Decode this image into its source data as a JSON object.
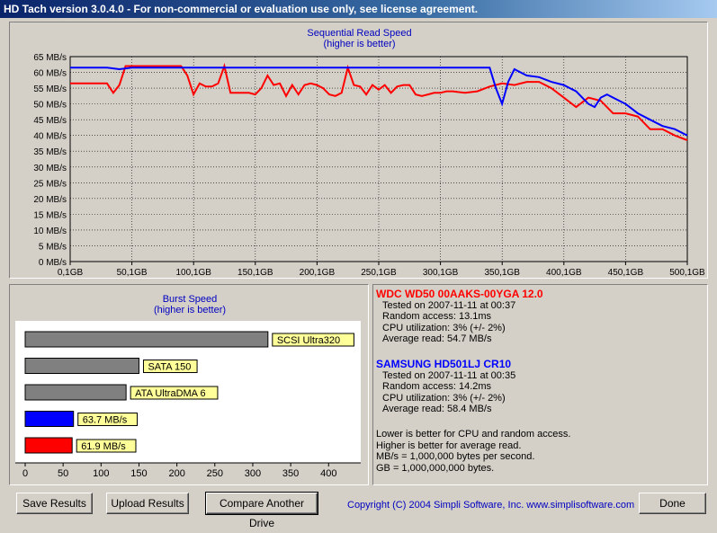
{
  "window": {
    "title": "HD Tach version 3.0.4.0  - For non-commercial or evaluation use only, see license agreement."
  },
  "seq_chart": {
    "title": "Sequential Read Speed",
    "subtitle": "(higher is better)"
  },
  "burst_chart": {
    "title": "Burst Speed",
    "subtitle": "(higher is better)"
  },
  "chart_data": [
    {
      "type": "line",
      "title": "Sequential Read Speed",
      "subtitle": "(higher is better)",
      "xlabel": "",
      "ylabel": "",
      "x_ticks": [
        "0,1GB",
        "50,1GB",
        "100,1GB",
        "150,1GB",
        "200,1GB",
        "250,1GB",
        "300,1GB",
        "350,1GB",
        "400,1GB",
        "450,1GB",
        "500,1GB"
      ],
      "y_ticks": [
        "0 MB/s",
        "5 MB/s",
        "10 MB/s",
        "15 MB/s",
        "20 MB/s",
        "25 MB/s",
        "30 MB/s",
        "35 MB/s",
        "40 MB/s",
        "45 MB/s",
        "50 MB/s",
        "55 MB/s",
        "60 MB/s",
        "65 MB/s"
      ],
      "xlim": [
        0.1,
        500.1
      ],
      "ylim": [
        0,
        65
      ],
      "grid": true,
      "series": [
        {
          "name": "WDC WD50 00AAKS-00YGA 12.0",
          "color": "#ff0000",
          "x": [
            0.1,
            10,
            20,
            30,
            35,
            40,
            45,
            50,
            55,
            60,
            65,
            70,
            75,
            80,
            85,
            90,
            95,
            100,
            105,
            110,
            115,
            120,
            125,
            130,
            135,
            140,
            145,
            150,
            155,
            160,
            165,
            170,
            175,
            180,
            185,
            190,
            195,
            200,
            205,
            210,
            215,
            220,
            225,
            230,
            235,
            240,
            245,
            250,
            255,
            260,
            265,
            270,
            275,
            280,
            285,
            290,
            295,
            300,
            305,
            310,
            320,
            330,
            340,
            350,
            360,
            370,
            380,
            390,
            400,
            410,
            420,
            430,
            440,
            450,
            460,
            470,
            480,
            490,
            500.1
          ],
          "y": [
            56.5,
            56.5,
            56.5,
            56.5,
            53.5,
            56,
            62,
            62,
            62,
            62,
            62,
            62,
            62,
            62,
            62,
            62,
            59,
            53,
            56.5,
            55.5,
            55.5,
            56.5,
            62,
            53.5,
            53.5,
            53.5,
            53.5,
            53,
            55,
            59,
            56,
            56.5,
            52.5,
            56,
            53,
            56,
            56.5,
            56,
            55,
            53,
            52.5,
            53.5,
            61.5,
            56,
            55.5,
            53,
            56,
            54.5,
            56,
            53.5,
            55.5,
            56,
            56,
            53,
            52.5,
            53,
            53.5,
            53.5,
            54,
            54,
            53.5,
            54,
            55.5,
            56.5,
            56,
            57,
            57,
            55,
            52,
            49,
            52,
            51,
            47,
            47,
            46,
            42,
            42,
            40,
            38.5
          ]
        },
        {
          "name": "SAMSUNG HD501LJ CR10",
          "color": "#0000ff",
          "x": [
            0.1,
            10,
            20,
            30,
            40,
            50,
            60,
            70,
            80,
            90,
            100,
            150,
            200,
            250,
            300,
            340,
            345,
            350,
            355,
            360,
            365,
            370,
            380,
            390,
            400,
            405,
            410,
            415,
            420,
            425,
            430,
            435,
            440,
            445,
            450,
            460,
            470,
            480,
            490,
            500.1
          ],
          "y": [
            61.5,
            61.5,
            61.5,
            61.5,
            61,
            61.5,
            61.5,
            61.5,
            61.5,
            61.5,
            61.5,
            61.5,
            61.5,
            61.5,
            61.5,
            61.5,
            55,
            50,
            57,
            61,
            60,
            59,
            58.5,
            57,
            56,
            55,
            54,
            52,
            50,
            49,
            52,
            53,
            52,
            51,
            50,
            47,
            45,
            43,
            42,
            40
          ]
        }
      ]
    },
    {
      "type": "bar",
      "title": "Burst Speed",
      "subtitle": "(higher is better)",
      "orientation": "horizontal",
      "x_ticks": [
        "0",
        "50",
        "100",
        "150",
        "200",
        "250",
        "300",
        "350",
        "400"
      ],
      "xlim": [
        0,
        440
      ],
      "categories": [
        "SCSI Ultra320",
        "SATA 150",
        "ATA UltraDMA 6",
        "63.7 MB/s",
        "61.9 MB/s"
      ],
      "values": [
        320,
        150,
        133,
        63.7,
        61.9
      ],
      "colors": [
        "#808080",
        "#808080",
        "#808080",
        "#0000ff",
        "#ff0000"
      ]
    }
  ],
  "drives": [
    {
      "name": "WDC WD50 00AAKS-00YGA 12.0",
      "tested": "Tested on 2007-11-11 at 00:37",
      "random": "Random access: 13.1ms",
      "cpu": "CPU utilization: 3% (+/- 2%)",
      "avg": "Average read: 54.7 MB/s"
    },
    {
      "name": "SAMSUNG HD501LJ CR10",
      "tested": "Tested on 2007-11-11 at 00:35",
      "random": "Random access: 14.2ms",
      "cpu": "CPU utilization: 3% (+/- 2%)",
      "avg": "Average read: 58.4 MB/s"
    }
  ],
  "notes": [
    "Lower is better for CPU and random access.",
    "Higher is better for average read.",
    "MB/s = 1,000,000 bytes per second.",
    "GB = 1,000,000,000 bytes."
  ],
  "buttons": {
    "save": "Save Results",
    "upload": "Upload Results",
    "compare": "Compare Another Drive",
    "done": "Done"
  },
  "copyright": "Copyright (C) 2004 Simpli Software, Inc. www.simplisoftware.com"
}
